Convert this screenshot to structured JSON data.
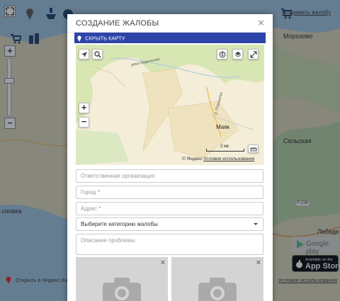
{
  "background": {
    "report_link": "Отправить жалобу",
    "labels": {
      "morozovo": "Морозово",
      "selskaya": "Сельская",
      "lebede": "Лебеде",
      "snovka": "сновка",
      "road": "P-236"
    },
    "footer": {
      "open_in_yandex": "Открыть в Яндекс.Картах",
      "terms": "Условия использования"
    },
    "google_play": "Google play",
    "app_store": {
      "available": "Available on the",
      "store": "App Store"
    }
  },
  "modal": {
    "title": "СОЗДАНИЕ ЖАЛОБЫ",
    "close": "×",
    "hide_map": "СКРЫТЬ КАРТУ",
    "map": {
      "place_label": "Маяк",
      "scale_label": "2 км",
      "copyright": "© Яндекс",
      "terms": "Условия использования",
      "zoom_in": "+",
      "zoom_out": "−"
    },
    "form": {
      "organization_placeholder": "Ответственная организация",
      "city_placeholder": "Город *",
      "address_placeholder": "Адрес *",
      "category_selected": "Выберите категорию жалобы",
      "description_placeholder": "Описание проблемы"
    },
    "photo_remove": "×"
  },
  "colors": {
    "accent_bar": "#2d45a8",
    "map_land": "#f4eed8",
    "map_forest": "#d8e6b4",
    "photo_bg": "#d4d4d4"
  }
}
